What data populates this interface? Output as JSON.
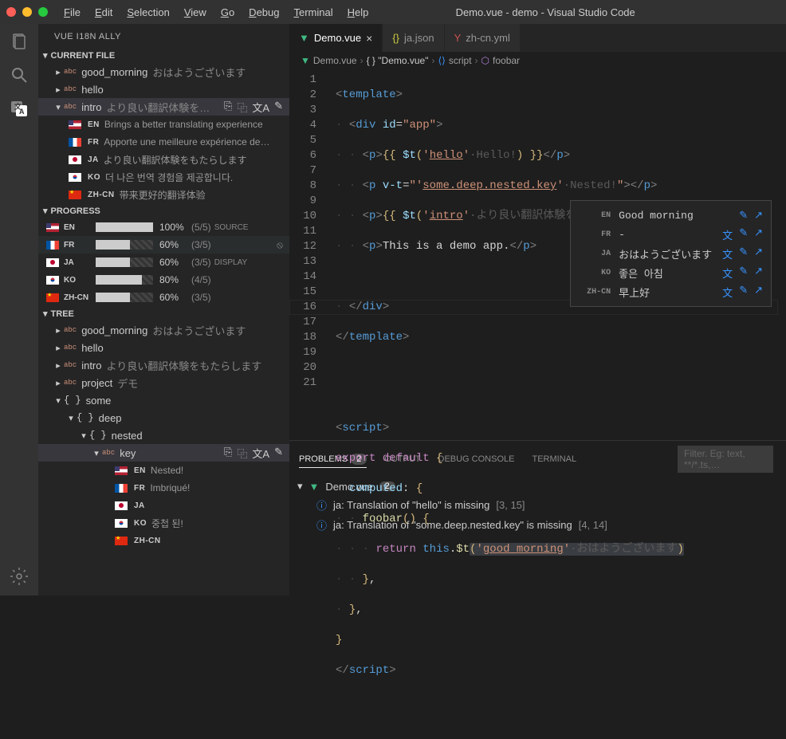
{
  "window": {
    "title": "Demo.vue - demo - Visual Studio Code"
  },
  "menu": [
    "File",
    "Edit",
    "Selection",
    "View",
    "Go",
    "Debug",
    "Terminal",
    "Help"
  ],
  "sidebar": {
    "title": "VUE I18N ALLY",
    "sections": {
      "currentFile": {
        "label": "CURRENT FILE",
        "items": [
          {
            "key": "good_morning",
            "val": "おはようございます"
          },
          {
            "key": "hello",
            "val": ""
          },
          {
            "key": "intro",
            "val": "より良い翻訳体験を…",
            "expanded": true,
            "langs": [
              {
                "code": "EN",
                "flag": "us",
                "text": "Brings a better translating experience"
              },
              {
                "code": "FR",
                "flag": "fr",
                "text": "Apporte une meilleure expérience de…"
              },
              {
                "code": "JA",
                "flag": "jp",
                "text": "より良い翻訳体験をもたらします"
              },
              {
                "code": "KO",
                "flag": "kr",
                "text": "더 나은 번역 경험을 제공합니다."
              },
              {
                "code": "ZH-CN",
                "flag": "cn",
                "text": "带来更好的翻译体验"
              }
            ]
          }
        ]
      },
      "progress": {
        "label": "PROGRESS",
        "rows": [
          {
            "code": "EN",
            "flag": "us",
            "pct": 100,
            "done": 5,
            "total": 5,
            "tag": "SOURCE"
          },
          {
            "code": "FR",
            "flag": "fr",
            "pct": 60,
            "done": 3,
            "total": 5,
            "hidden": true
          },
          {
            "code": "JA",
            "flag": "jp",
            "pct": 60,
            "done": 3,
            "total": 5,
            "tag": "DISPLAY"
          },
          {
            "code": "KO",
            "flag": "kr",
            "pct": 80,
            "done": 4,
            "total": 5
          },
          {
            "code": "ZH-CN",
            "flag": "cn",
            "pct": 60,
            "done": 3,
            "total": 5
          }
        ]
      },
      "tree": {
        "label": "TREE",
        "items": [
          {
            "key": "good_morning",
            "val": "おはようございます"
          },
          {
            "key": "hello",
            "val": ""
          },
          {
            "key": "intro",
            "val": "より良い翻訳体験をもたらします"
          },
          {
            "key": "project",
            "val": "デモ"
          }
        ],
        "some": "some",
        "deep": "deep",
        "nested": "nested",
        "keyNode": "key",
        "keyLangs": [
          {
            "code": "EN",
            "flag": "us",
            "text": "Nested!"
          },
          {
            "code": "FR",
            "flag": "fr",
            "text": "Imbriqué!"
          },
          {
            "code": "JA",
            "flag": "jp",
            "text": ""
          },
          {
            "code": "KO",
            "flag": "kr",
            "text": "중첩 된!"
          },
          {
            "code": "ZH-CN",
            "flag": "cn",
            "text": ""
          }
        ]
      }
    }
  },
  "tabs": [
    {
      "label": "Demo.vue",
      "icon": "vue",
      "active": true
    },
    {
      "label": "ja.json",
      "icon": "json"
    },
    {
      "label": "zh-cn.yml",
      "icon": "yaml"
    }
  ],
  "breadcrumb": {
    "file": "Demo.vue",
    "obj": "{ } \"Demo.vue\"",
    "script": "script",
    "fn": "foobar"
  },
  "hover": {
    "rows": [
      {
        "code": "EN",
        "text": "Good morning",
        "icons": [
          "pencil",
          "open"
        ]
      },
      {
        "code": "FR",
        "text": "-",
        "icons": [
          "trans",
          "pencil",
          "open"
        ]
      },
      {
        "code": "JA",
        "text": "おはようございます",
        "icons": [
          "trans",
          "pencil",
          "open"
        ]
      },
      {
        "code": "KO",
        "text": "좋은 아침",
        "icons": [
          "trans",
          "pencil",
          "open"
        ]
      },
      {
        "code": "ZH-CN",
        "text": "早上好",
        "icons": [
          "trans",
          "pencil",
          "open"
        ]
      }
    ]
  },
  "panel": {
    "tabs": {
      "problems": "PROBLEMS",
      "problemsCount": "2",
      "output": "OUTPUT",
      "debug": "DEBUG CONSOLE",
      "terminal": "TERMINAL"
    },
    "filter": "Filter. Eg: text, **/*.ts,…",
    "file": "Demo.vue",
    "fileCount": "2",
    "items": [
      {
        "msg": "ja: Translation of \"hello\" is missing",
        "loc": "[3, 15]"
      },
      {
        "msg": "ja: Translation of \"some.deep.nested.key\" is missing",
        "loc": "[4, 14]"
      }
    ]
  }
}
